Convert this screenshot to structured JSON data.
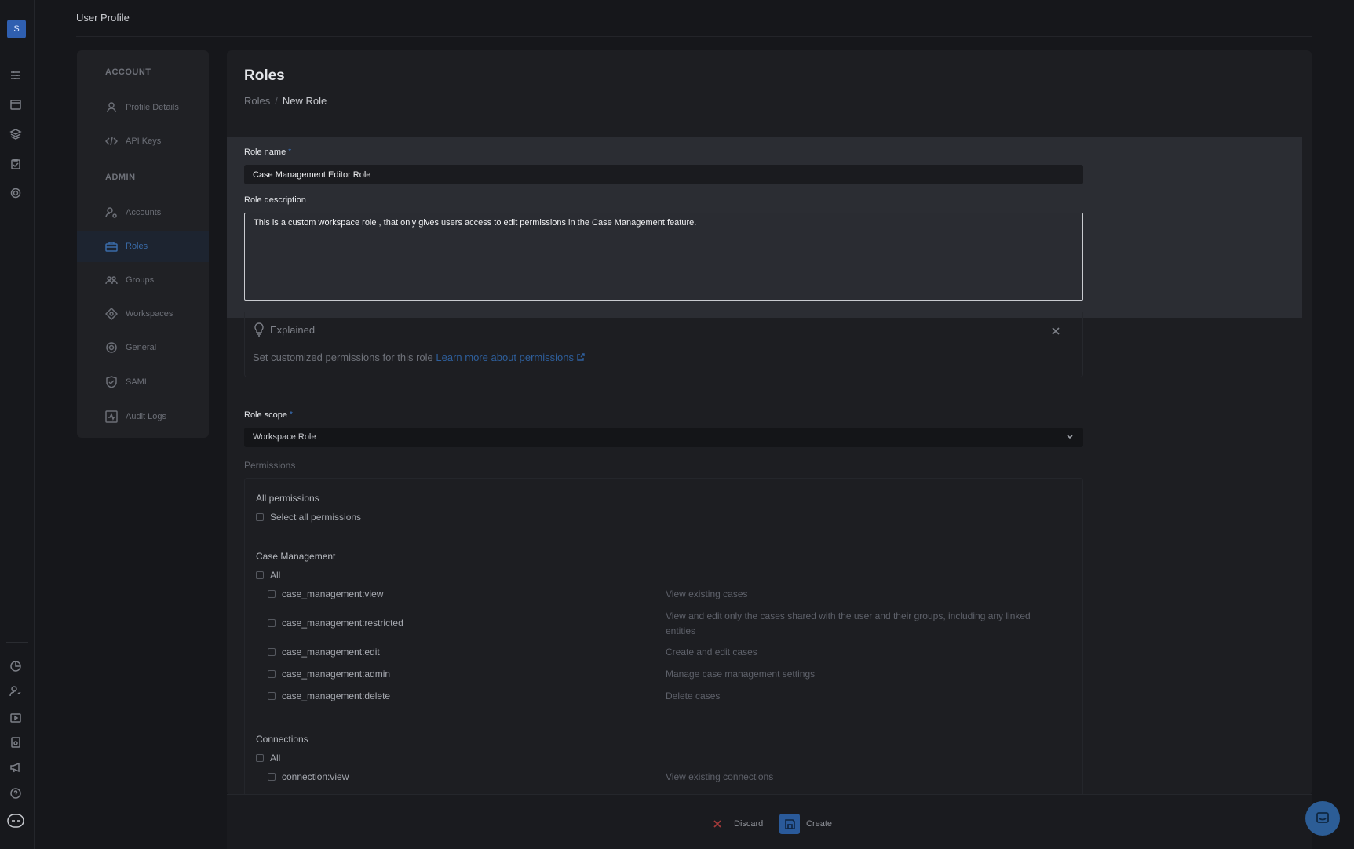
{
  "app": {
    "avatar_letter": "S",
    "page_title": "User Profile"
  },
  "sidenav": {
    "sections": [
      {
        "label": "ACCOUNT",
        "items": [
          {
            "label": "Profile Details",
            "icon": "user-icon"
          },
          {
            "label": "API Keys",
            "icon": "code-icon"
          }
        ]
      },
      {
        "label": "ADMIN",
        "items": [
          {
            "label": "Accounts",
            "icon": "users-cog-icon"
          },
          {
            "label": "Roles",
            "icon": "briefcase-icon",
            "active": true
          },
          {
            "label": "Groups",
            "icon": "group-icon"
          },
          {
            "label": "Workspaces",
            "icon": "workspace-icon"
          },
          {
            "label": "General",
            "icon": "settings-icon"
          },
          {
            "label": "SAML",
            "icon": "shield-icon"
          },
          {
            "label": "Audit Logs",
            "icon": "activity-icon"
          }
        ]
      }
    ]
  },
  "main": {
    "title": "Roles",
    "breadcrumb": [
      "Roles",
      "New Role"
    ],
    "form": {
      "role_name_label": "Role name",
      "role_name_value": "Case Management Editor Role",
      "role_description_label": "Role description",
      "role_description_value": "This is a custom workspace role , that only gives users access to edit permissions in the Case Management feature.",
      "required_marker": "*"
    },
    "explained": {
      "title": "Explained",
      "text": "Set customized permissions for this role",
      "link": "Learn more about permissions"
    },
    "role_scope": {
      "label": "Role scope",
      "value": "Workspace Role"
    },
    "permissions": {
      "heading": "Permissions",
      "all": {
        "title": "All permissions",
        "select_all": "Select all permissions"
      },
      "groups": [
        {
          "title": "Case Management",
          "all_label": "All",
          "items": [
            {
              "name": "case_management:view",
              "desc": "View existing cases"
            },
            {
              "name": "case_management:restricted",
              "desc": "View and edit only the cases shared with the user and their groups, including any linked entities"
            },
            {
              "name": "case_management:edit",
              "desc": "Create and edit cases"
            },
            {
              "name": "case_management:admin",
              "desc": "Manage case management settings"
            },
            {
              "name": "case_management:delete",
              "desc": "Delete cases"
            }
          ]
        },
        {
          "title": "Connections",
          "all_label": "All",
          "items": [
            {
              "name": "connection:view",
              "desc": "View existing connections"
            }
          ]
        }
      ]
    }
  },
  "actions": {
    "discard": "Discard",
    "create": "Create"
  }
}
